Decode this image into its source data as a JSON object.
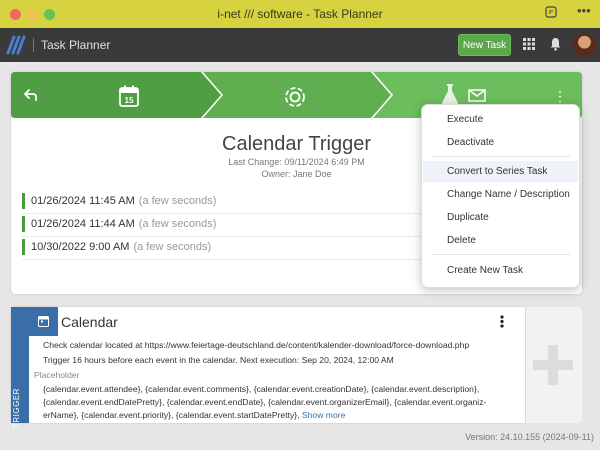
{
  "window": {
    "title": "i-net /// software - Task Planner"
  },
  "header": {
    "app_title": "Task Planner",
    "new_task_label": "New Task"
  },
  "task": {
    "title": "Calendar Trigger",
    "last_change": "Last Change: 09/11/2024 6:49 PM",
    "owner": "Owner: Jane Doe",
    "calendar_day": "15",
    "runs": [
      {
        "time": "01/26/2024 11:45 AM",
        "relative": "(a few seconds)"
      },
      {
        "time": "01/26/2024 11:44 AM",
        "relative": "(a few seconds)"
      },
      {
        "time": "10/30/2022 9:00 AM",
        "relative": "(a few seconds)"
      }
    ]
  },
  "menu": {
    "items": [
      "Execute",
      "Deactivate",
      "Convert to Series Task",
      "Change Name / Description",
      "Duplicate",
      "Delete",
      "Create New Task"
    ],
    "highlighted": "Convert to Series Task"
  },
  "trigger": {
    "side_label": "TRIGGER",
    "title": "Calendar",
    "line1": "Check calendar located at https://www.feiertage-deutschland.de/content/kalender-download/force-download.php",
    "line2": "Trigger 16 hours before each event in the calendar. Next execution: Sep 20, 2024, 12:00 AM",
    "placeholder_label": "Placeholder",
    "placeholder_line1": "{calendar.event.attendee}, {calendar.event.comments}, {calendar.event.creationDate}, {calendar.event.description},",
    "placeholder_line2": "{calendar.event.endDatePretty}, {calendar.event.endDate}, {calendar.event.organizerEmail}, {calendar.event.organiz-",
    "placeholder_line3": "erName}, {calendar.event.priority}, {calendar.event.startDatePretty},",
    "show_more": "Show more"
  },
  "footer": {
    "version": "Version: 24.10.155 (2024-09-11)"
  },
  "colors": {
    "accent_green": "#5aa84a",
    "trigger_blue": "#3a6ea8",
    "titlebar": "#d7d23f",
    "header": "#3a3a3a"
  }
}
